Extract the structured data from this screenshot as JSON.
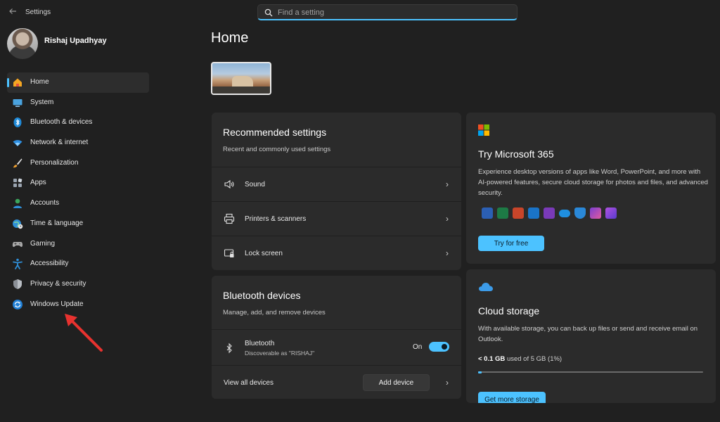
{
  "window": {
    "title": "Settings",
    "back_icon": "arrow-left-icon"
  },
  "search": {
    "placeholder": "Find a setting",
    "value": ""
  },
  "profile": {
    "name": "Rishaj Upadhyay"
  },
  "sidebar": {
    "items": [
      {
        "label": "Home",
        "icon": "home-icon",
        "active": true
      },
      {
        "label": "System",
        "icon": "monitor-icon"
      },
      {
        "label": "Bluetooth & devices",
        "icon": "bluetooth-icon"
      },
      {
        "label": "Network & internet",
        "icon": "wifi-icon"
      },
      {
        "label": "Personalization",
        "icon": "brush-icon"
      },
      {
        "label": "Apps",
        "icon": "apps-icon"
      },
      {
        "label": "Accounts",
        "icon": "person-icon"
      },
      {
        "label": "Time & language",
        "icon": "globe-clock-icon"
      },
      {
        "label": "Gaming",
        "icon": "gamepad-icon"
      },
      {
        "label": "Accessibility",
        "icon": "accessibility-icon"
      },
      {
        "label": "Privacy & security",
        "icon": "shield-icon"
      },
      {
        "label": "Windows Update",
        "icon": "update-icon"
      }
    ]
  },
  "main": {
    "title": "Home",
    "recommended": {
      "title": "Recommended settings",
      "subtitle": "Recent and commonly used settings",
      "rows": [
        {
          "label": "Sound",
          "icon": "speaker-icon"
        },
        {
          "label": "Printers & scanners",
          "icon": "printer-icon"
        },
        {
          "label": "Lock screen",
          "icon": "lock-screen-icon"
        }
      ]
    },
    "bluetooth": {
      "title": "Bluetooth devices",
      "subtitle": "Manage, add, and remove devices",
      "device_name": "Bluetooth",
      "device_status": "Discoverable as \"RISHAJ\"",
      "toggle_label": "On",
      "toggle_on": true,
      "view_all": "View all devices",
      "add_device": "Add device"
    },
    "m365": {
      "title": "Try Microsoft 365",
      "description": "Experience desktop versions of apps like Word, PowerPoint, and more with AI-powered features, secure cloud storage for photos and files, and advanced security.",
      "button": "Try for free",
      "app_icons": [
        "word-icon",
        "excel-icon",
        "powerpoint-icon",
        "outlook-icon",
        "onenote-icon",
        "onedrive-icon",
        "defender-icon",
        "clipchamp-icon",
        "designer-icon"
      ]
    },
    "cloud": {
      "title": "Cloud storage",
      "description": "With available storage, you can back up files or send and receive email on Outlook.",
      "used": "< 0.1 GB",
      "total_text": "used of 5 GB (1%)",
      "percent_used": 1,
      "button": "Get more storage"
    }
  },
  "colors": {
    "accent": "#4cc2ff",
    "background": "#202020",
    "card": "#2b2b2b",
    "annotation_arrow": "#e8322f"
  }
}
